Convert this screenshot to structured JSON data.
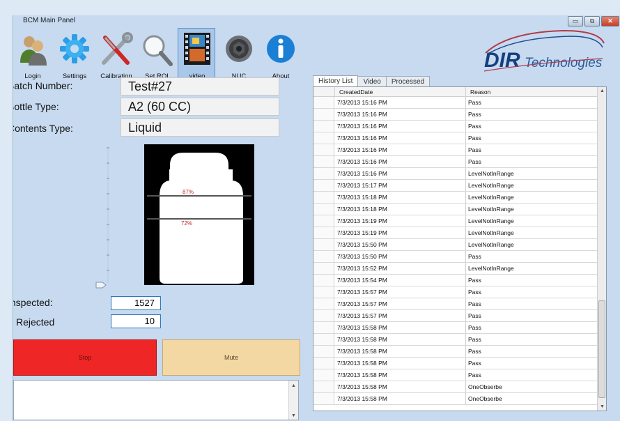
{
  "window": {
    "title": "BCM Main Panel",
    "buttons": {
      "minimize": "▭",
      "restore": "⧉",
      "close": "✕"
    }
  },
  "toolbar": [
    {
      "key": "login",
      "label": "Login",
      "icon": "users-icon"
    },
    {
      "key": "settings",
      "label": "Settings",
      "icon": "gear-icon"
    },
    {
      "key": "calibration",
      "label": "Calibration",
      "icon": "tools-icon"
    },
    {
      "key": "set_roi",
      "label": "Set ROI",
      "icon": "magnifier-icon"
    },
    {
      "key": "video",
      "label": "video",
      "icon": "film-icon",
      "active": true
    },
    {
      "key": "nuc",
      "label": "NUC",
      "icon": "lens-icon"
    },
    {
      "key": "about",
      "label": "About",
      "icon": "info-icon"
    }
  ],
  "logo": {
    "brand": "DIR",
    "suffix": "Technologies"
  },
  "form": {
    "batch_label": "Batch Number:",
    "batch_value": "Test#27",
    "bottle_label": "Bottle Type:",
    "bottle_value": "A2 (60 CC)",
    "contents_label": "Contents Type:",
    "contents_value": "Liquid"
  },
  "bottle_view": {
    "upper_level_label": "87%",
    "lower_level_label": "72%"
  },
  "counts": {
    "inspected_label": "Inspected:",
    "inspected_value": "1527",
    "rejected_label": "Rejected",
    "rejected_value": "10"
  },
  "actions": {
    "stop_label": "Stop",
    "mute_label": "Mute"
  },
  "tabs": [
    {
      "label": "History List",
      "active": true
    },
    {
      "label": "Video",
      "active": false
    },
    {
      "label": "Processed",
      "active": false
    }
  ],
  "history": {
    "columns": {
      "date": "CreatedDate",
      "reason": "Reason"
    },
    "rows": [
      {
        "date": "7/3/2013 15:16 PM",
        "reason": "Pass"
      },
      {
        "date": "7/3/2013 15:16 PM",
        "reason": "Pass"
      },
      {
        "date": "7/3/2013 15:16 PM",
        "reason": "Pass"
      },
      {
        "date": "7/3/2013 15:16 PM",
        "reason": "Pass"
      },
      {
        "date": "7/3/2013 15:16 PM",
        "reason": "Pass"
      },
      {
        "date": "7/3/2013 15:16 PM",
        "reason": "Pass"
      },
      {
        "date": "7/3/2013 15:16 PM",
        "reason": "LevelNotInRange"
      },
      {
        "date": "7/3/2013 15:17 PM",
        "reason": "LevelNotInRange"
      },
      {
        "date": "7/3/2013 15:18 PM",
        "reason": "LevelNotInRange"
      },
      {
        "date": "7/3/2013 15:18 PM",
        "reason": "LevelNotInRange"
      },
      {
        "date": "7/3/2013 15:19 PM",
        "reason": "LevelNotInRange"
      },
      {
        "date": "7/3/2013 15:19 PM",
        "reason": "LevelNotInRange"
      },
      {
        "date": "7/3/2013 15:50 PM",
        "reason": "LevelNotInRange"
      },
      {
        "date": "7/3/2013 15:50 PM",
        "reason": "Pass"
      },
      {
        "date": "7/3/2013 15:52 PM",
        "reason": "LevelNotInRange"
      },
      {
        "date": "7/3/2013 15:54 PM",
        "reason": "Pass"
      },
      {
        "date": "7/3/2013 15:57 PM",
        "reason": "Pass"
      },
      {
        "date": "7/3/2013 15:57 PM",
        "reason": "Pass"
      },
      {
        "date": "7/3/2013 15:57 PM",
        "reason": "Pass"
      },
      {
        "date": "7/3/2013 15:58 PM",
        "reason": "Pass"
      },
      {
        "date": "7/3/2013 15:58 PM",
        "reason": "Pass"
      },
      {
        "date": "7/3/2013 15:58 PM",
        "reason": "Pass"
      },
      {
        "date": "7/3/2013 15:58 PM",
        "reason": "Pass"
      },
      {
        "date": "7/3/2013 15:58 PM",
        "reason": "Pass"
      },
      {
        "date": "7/3/2013 15:58 PM",
        "reason": "OneObserbe"
      },
      {
        "date": "7/3/2013 15:58 PM",
        "reason": "OneObserbe"
      }
    ]
  },
  "colors": {
    "window_bg": "#c7daf0",
    "stop": "#ee2626",
    "mute": "#f4d8a4",
    "accent": "#2a79b8"
  }
}
